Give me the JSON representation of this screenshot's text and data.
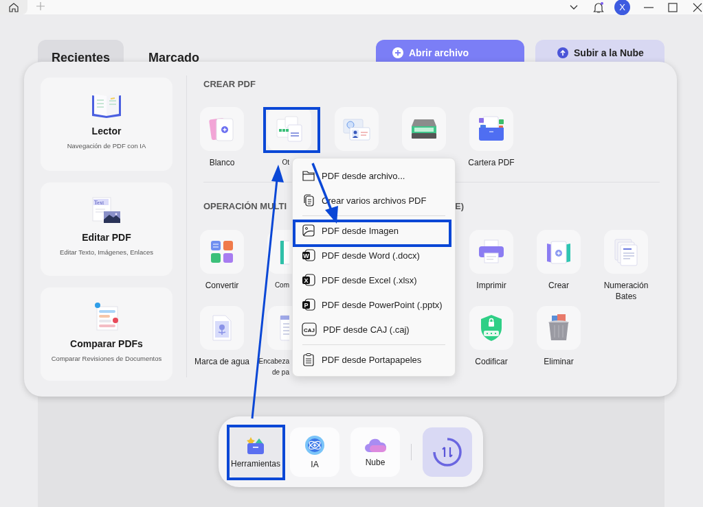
{
  "title_bar": {
    "avatar": "X"
  },
  "home": {
    "tabs": [
      {
        "label": "Recientes",
        "selected": true
      },
      {
        "label": "Marcado",
        "selected": false
      }
    ],
    "actions": [
      {
        "label": "Abrir archivo",
        "kind": "primary"
      },
      {
        "label": "Subir a la Nube",
        "kind": "secondary"
      }
    ]
  },
  "tools_panel": {
    "cards": [
      {
        "title": "Lector",
        "subtitle": "Navegación de PDF con IA"
      },
      {
        "title": "Editar PDF",
        "subtitle": "Editar Texto, Imágenes, Enlaces",
        "icon_text": "Text"
      },
      {
        "title": "Comparar PDFs",
        "subtitle": "Comparar Revisiones de Documentos"
      }
    ],
    "create": {
      "title": "CREAR PDF",
      "items": [
        {
          "kind": "tool",
          "label": "Blanco"
        },
        {
          "kind": "cut",
          "label": "Ot"
        },
        {
          "kind": "covered"
        },
        {
          "kind": "covered"
        },
        {
          "kind": "tool",
          "label": "Cartera PDF"
        }
      ]
    },
    "operations": {
      "title": "OPERACIÓN MULTI",
      "title_tail": "E)",
      "rows": [
        {
          "left": [
            {
              "kind": "tool",
              "label": "Convertir"
            },
            {
              "kind": "cut",
              "label": "Com"
            }
          ],
          "right": [
            {
              "kind": "tool",
              "label": "Imprimir"
            },
            {
              "kind": "tool",
              "label": "Crear"
            },
            {
              "kind": "tool",
              "label": "Numeración Bates"
            }
          ]
        },
        {
          "left": [
            {
              "kind": "tool",
              "label": "Marca de agua"
            },
            {
              "kind": "cut",
              "label": "Encabeza\nde pa"
            }
          ],
          "right": [
            {
              "kind": "tool",
              "label": "Codificar"
            },
            {
              "kind": "tool",
              "label": "Eliminar"
            }
          ]
        }
      ]
    }
  },
  "menu": {
    "groups": [
      [
        {
          "label": "PDF desde archivo..."
        },
        {
          "label": "Crear varios archivos PDF"
        }
      ],
      [
        {
          "label": "PDF desde Imagen"
        },
        {
          "label": "PDF desde Word (.docx)",
          "badge": "W"
        },
        {
          "label": "PDF desde Excel (.xlsx)",
          "badge": "X"
        },
        {
          "label": "PDF desde PowerPoint (.pptx)",
          "badge": "P"
        },
        {
          "label": "PDF desde CAJ (.caj)",
          "badge": "CAJ"
        }
      ],
      [
        {
          "label": "PDF desde Portapapeles"
        }
      ]
    ]
  },
  "dock": {
    "items": [
      {
        "label": "Herramientas",
        "selected": true
      },
      {
        "label": "IA",
        "selected": false
      },
      {
        "label": "Nube",
        "selected": false
      }
    ]
  }
}
